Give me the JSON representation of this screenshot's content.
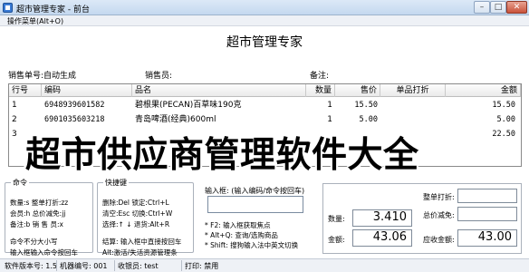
{
  "window": {
    "title": "超市管理专家 - 前台",
    "min": "–",
    "max": "□",
    "close": "✕"
  },
  "menu": {
    "operation": "操作菜单(Alt+O)"
  },
  "app_heading": "超市管理专家",
  "info": {
    "sale_no": "销售单号:自动生成",
    "clerk": "销售员:",
    "remark": "备注:"
  },
  "table": {
    "headers": [
      "行号",
      "编码",
      "品名",
      "数量",
      "售价",
      "单品打折",
      "金额"
    ],
    "rows": [
      [
        "1",
        "6948939601582",
        "碧根果(PECAN)百草味190克",
        "1",
        "15.50",
        "",
        "15.50"
      ],
      [
        "2",
        "6901035603218",
        "青岛啤酒(经典)600ml",
        "1",
        "5.00",
        "",
        "5.00"
      ],
      [
        "3",
        "",
        "",
        "",
        "",
        "",
        "22.50"
      ]
    ]
  },
  "watermark": "超市供应商管理软件大全",
  "commands": {
    "legend": "命令",
    "lines": [
      "数量:s   整单打折:zz",
      "会员:h   总价减免:jj",
      "备注:b   销 售 员:x"
    ],
    "foot": [
      "命令不分大小写",
      "输入框输入命令按回车"
    ]
  },
  "shortcuts": {
    "legend": "快捷键",
    "lines": [
      "删除:Del   锁定:Ctrl+L",
      "清空:Esc   切换:Ctrl+W",
      "选择:↑ ↓   退货:Alt+R"
    ],
    "foot": [
      "结算: 输入框中直接按回车",
      "Alt:激活/失活资源管理条"
    ]
  },
  "input": {
    "label": "输入框: (输入编码/命令按回车)",
    "hints": [
      "* F2: 输入框获取焦点",
      "* Alt+Q: 查询/选购商品",
      "* Shift: 搜狗输入法中英文切换"
    ]
  },
  "summary": {
    "whole_discount_label": "整单打折:",
    "total_reduction_label": "总价减免:",
    "qty_label": "数量:",
    "qty_value": "3.410",
    "amount_label": "金额:",
    "amount_value": "43.06",
    "receivable_label": "应收金额:",
    "receivable_value": "43.00"
  },
  "status": {
    "version": "软件版本号: 1.5",
    "machine": "机器编号: 001",
    "cashier": "收银员: test",
    "print": "打印: 禁用"
  }
}
